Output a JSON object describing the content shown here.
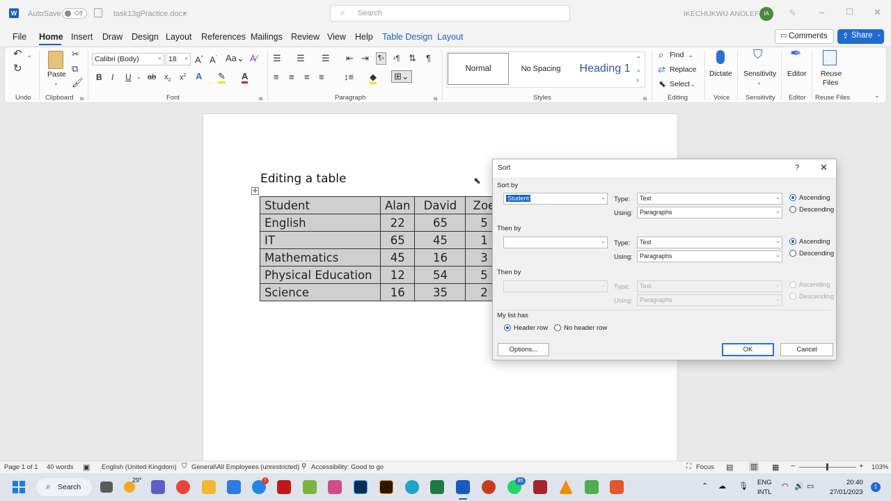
{
  "titlebar": {
    "autosave_label": "AutoSave",
    "autosave_state": "Off",
    "filename": "task13gPractice.docx",
    "search_placeholder": "Search",
    "user_name": "IKECHUKWU ANOLEFO",
    "user_initials": "IA"
  },
  "menu": {
    "items": [
      "File",
      "Home",
      "Insert",
      "Draw",
      "Design",
      "Layout",
      "References",
      "Mailings",
      "Review",
      "View",
      "Help",
      "Table Design",
      "Layout"
    ],
    "comments_label": "Comments",
    "share_label": "Share"
  },
  "ribbon": {
    "font_name": "Calibri (Body)",
    "font_size": "18",
    "paste_label": "Paste",
    "styles": [
      "Normal",
      "No Spacing",
      "Heading 1"
    ],
    "find_label": "Find",
    "replace_label": "Replace",
    "select_label": "Select",
    "dictate_label": "Dictate",
    "sensitivity_label": "Sensitivity",
    "editor_label": "Editor",
    "reuse_label": "Reuse Files",
    "group_labels": [
      "Undo",
      "Clipboard",
      "Font",
      "Paragraph",
      "Styles",
      "Editing",
      "Voice",
      "Sensitivity",
      "Editor",
      "Reuse Files"
    ]
  },
  "document": {
    "title": "Editing a table",
    "rows": [
      [
        "Student",
        "Alan",
        "David",
        "Zoe"
      ],
      [
        "English",
        "22",
        "65",
        "5"
      ],
      [
        "IT",
        "65",
        "45",
        "1"
      ],
      [
        "Mathematics",
        "45",
        "16",
        "3"
      ],
      [
        "Physical Education",
        "12",
        "54",
        "5"
      ],
      [
        "Science",
        "16",
        "35",
        "2"
      ]
    ]
  },
  "dialog": {
    "title": "Sort",
    "help": "?",
    "sort_by_label": "Sort by",
    "then_by_label": "Then by",
    "type_label": "Type:",
    "using_label": "Using:",
    "sort_by_value": "Student",
    "type_value": "Text",
    "using_value": "Paragraphs",
    "ascending_label": "Ascending",
    "descending_label": "Descending",
    "my_list_has_label": "My list has",
    "header_row_label": "Header row",
    "no_header_row_label": "No header row",
    "options_label": "Options...",
    "ok_label": "OK",
    "cancel_label": "Cancel"
  },
  "statusbar": {
    "page": "Page 1 of 1",
    "words": "40 words",
    "language": "English (United Kingdom)",
    "sensitivity": "General\\All Employees (unrestricted)",
    "accessibility": "Accessibility: Good to go",
    "focus": "Focus",
    "zoom": "103%"
  },
  "taskbar": {
    "search_label": "Search",
    "weather": "29°",
    "lang_top": "ENG",
    "lang_bottom": "INTL",
    "time": "20:40",
    "date": "27/01/2023",
    "whatsapp_badge": "85",
    "notification_count": "1"
  },
  "colors": {
    "word_blue": "#185abd",
    "table_shading": "#cfcfcf",
    "dialog_bg": "#f0f0f0",
    "accent": "#1a74d8"
  }
}
